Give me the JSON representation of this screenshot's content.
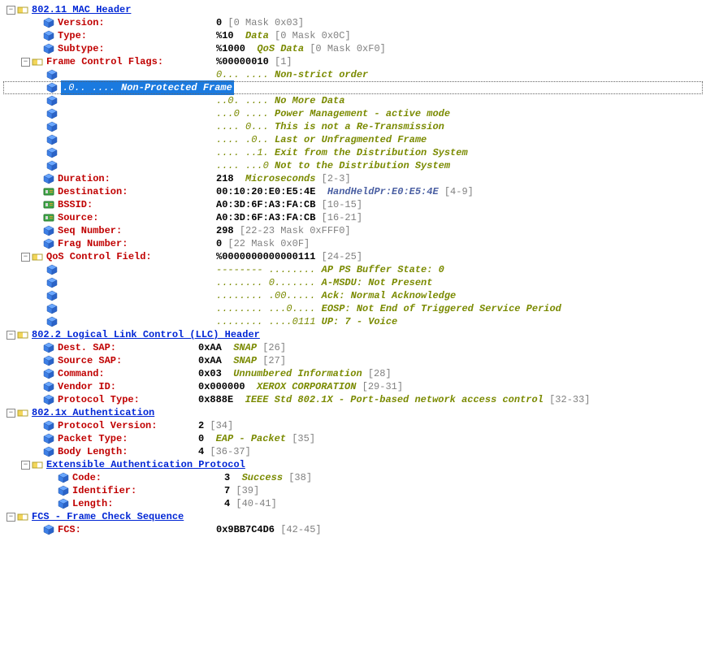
{
  "sections": {
    "mac": {
      "title": "802.11 MAC Header",
      "version": {
        "label": "Version:",
        "val": "0",
        "off": "[0 Mask 0x03]"
      },
      "type": {
        "label": "Type:",
        "val": "%10",
        "desc": "Data",
        "off": "[0 Mask 0x0C]"
      },
      "subtype": {
        "label": "Subtype:",
        "val": "%1000",
        "desc": "QoS Data",
        "off": "[0 Mask 0xF0]"
      },
      "fcf": {
        "label": "Frame Control Flags:",
        "val": "%00000010",
        "off": "[1]",
        "bits": [
          {
            "pat": "0... .... ",
            "desc": "Non-strict order"
          },
          {
            "pat": ".0.. .... ",
            "desc": "Non-Protected Frame"
          },
          {
            "pat": "..0. .... ",
            "desc": "No More Data"
          },
          {
            "pat": "...0 .... ",
            "desc": "Power Management - active mode"
          },
          {
            "pat": ".... 0... ",
            "desc": "This is not a Re-Transmission"
          },
          {
            "pat": ".... .0.. ",
            "desc": "Last or Unfragmented Frame"
          },
          {
            "pat": ".... ..1. ",
            "desc": "Exit from the Distribution System"
          },
          {
            "pat": ".... ...0 ",
            "desc": "Not to the Distribution System"
          }
        ]
      },
      "duration": {
        "label": "Duration:",
        "val": "218",
        "desc": "Microseconds",
        "off": "[2-3]"
      },
      "dest": {
        "label": "Destination:",
        "val": "00:10:20:E0:E5:4E",
        "desc": "HandHeldPr:E0:E5:4E",
        "off": "[4-9]"
      },
      "bssid": {
        "label": "BSSID:",
        "val": "A0:3D:6F:A3:FA:CB",
        "off": "[10-15]"
      },
      "source": {
        "label": "Source:",
        "val": "A0:3D:6F:A3:FA:CB",
        "off": "[16-21]"
      },
      "seq": {
        "label": "Seq Number:",
        "val": "298",
        "off": "[22-23 Mask 0xFFF0]"
      },
      "frag": {
        "label": "Frag Number:",
        "val": "0",
        "off": "[22 Mask 0x0F]"
      },
      "qos": {
        "label": "QoS Control Field:",
        "val": "%0000000000000111",
        "off": "[24-25]",
        "bits": [
          {
            "pat": "-------- ........ ",
            "desc": "AP PS Buffer State: 0"
          },
          {
            "pat": "........ 0....... ",
            "desc": "A-MSDU: Not Present"
          },
          {
            "pat": "........ .00..... ",
            "desc": "Ack: Normal Acknowledge"
          },
          {
            "pat": "........ ...0.... ",
            "desc": "EOSP: Not End of Triggered Service Period"
          },
          {
            "pat": "........ ....0111 ",
            "desc": "UP: 7 - Voice"
          }
        ]
      }
    },
    "llc": {
      "title": "802.2 Logical Link Control (LLC) Header",
      "dsap": {
        "label": "Dest. SAP:",
        "val": "0xAA",
        "desc": "SNAP",
        "off": "[26]"
      },
      "ssap": {
        "label": "Source SAP:",
        "val": "0xAA",
        "desc": "SNAP",
        "off": "[27]"
      },
      "cmd": {
        "label": "Command:",
        "val": "0x03",
        "desc": "Unnumbered Information",
        "off": "[28]"
      },
      "vendor": {
        "label": "Vendor ID:",
        "val": "0x000000",
        "desc": "XEROX CORPORATION",
        "off": "[29-31]"
      },
      "ptype": {
        "label": "Protocol Type:",
        "val": "0x888E",
        "desc": "IEEE Std 802.1X - Port-based network access control",
        "off": "[32-33]"
      }
    },
    "dot1x": {
      "title": "802.1x Authentication",
      "pver": {
        "label": "Protocol Version:",
        "val": "2",
        "off": "[34]"
      },
      "ptype": {
        "label": "Packet Type:",
        "val": "0",
        "desc": "EAP - Packet",
        "off": "[35]"
      },
      "blen": {
        "label": "Body Length:",
        "val": "4",
        "off": "[36-37]"
      },
      "eap": {
        "title": "Extensible Authentication Protocol",
        "code": {
          "label": "Code:",
          "val": "3",
          "desc": "Success",
          "off": "[38]"
        },
        "id": {
          "label": "Identifier:",
          "val": "7",
          "off": "[39]"
        },
        "len": {
          "label": "Length:",
          "val": "4",
          "off": "[40-41]"
        }
      }
    },
    "fcs": {
      "title": "FCS - Frame Check Sequence",
      "fcs": {
        "label": "FCS:",
        "val": "0x9BB7C4D6",
        "off": "[42-45]"
      }
    }
  }
}
